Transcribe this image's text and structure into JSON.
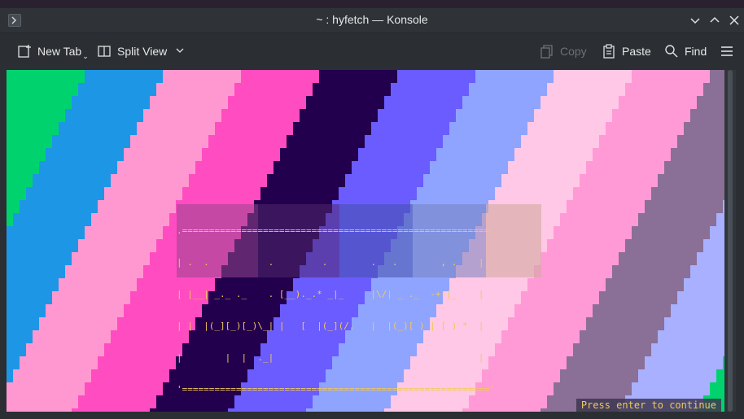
{
  "window": {
    "title": "~ : hyfetch — Konsole"
  },
  "toolbar": {
    "new_tab": "New Tab",
    "split_view": "Split View",
    "copy": "Copy",
    "paste": "Paste",
    "find": "Find"
  },
  "terminal": {
    "banner_lines": [
      ".=========================================================.",
      "| .  .           .         .        .   .        , .    |",
      "| |__| _._ ._    . [__)._.* _|_     |\\/| _ ._  -+-|_    |",
      "| |  |(_][_)[_)\\_| |   [  |(_](/,   |  |(_)[ ) | [ ) *  |",
      "|        |  |  ._|                                      |",
      "'========================================================='"
    ],
    "press_text": "Press enter to continue",
    "stripe_colors": [
      "#00d36e",
      "#1e96e6",
      "#ff98d0",
      "#ff4cc0",
      "#23004e",
      "#6a5cff",
      "#8fa4ff",
      "#ffc8e6",
      "#ff9ad6",
      "#8a6f96",
      "#a8b0ff"
    ]
  }
}
